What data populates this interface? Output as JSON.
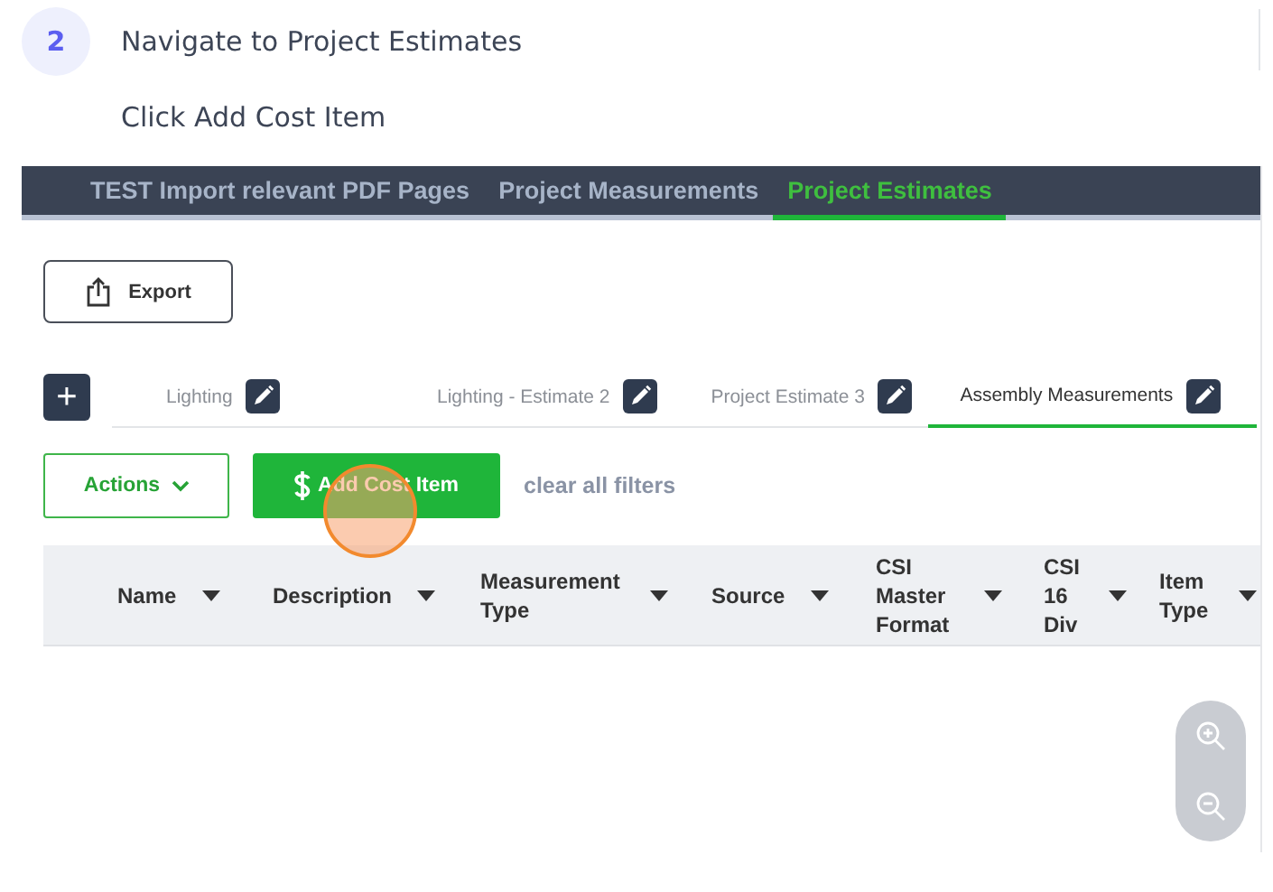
{
  "step": {
    "number": "2",
    "title": "Navigate to Project Estimates",
    "instruction": "Click Add Cost Item"
  },
  "nav_tabs": [
    {
      "label": "TEST Import relevant PDF Pages",
      "selected": false
    },
    {
      "label": "Project Measurements",
      "selected": false
    },
    {
      "label": "Project Estimates",
      "selected": true
    }
  ],
  "export_button": "Export",
  "add_tab_button": "+",
  "estimate_tabs": [
    {
      "label": "Lighting",
      "selected": false
    },
    {
      "label": "Lighting - Estimate 2",
      "selected": false
    },
    {
      "label": "Project Estimate 3",
      "selected": false
    },
    {
      "label": "Assembly Measurements",
      "selected": true
    }
  ],
  "actions_button": "Actions",
  "add_cost_item_button": "Add Cost Item",
  "clear_filters_link": "clear all filters",
  "table": {
    "columns": [
      "Name",
      "Description",
      "Measurement Type",
      "Source",
      "CSI Master Format",
      "CSI 16 Div",
      "Item Type"
    ]
  }
}
